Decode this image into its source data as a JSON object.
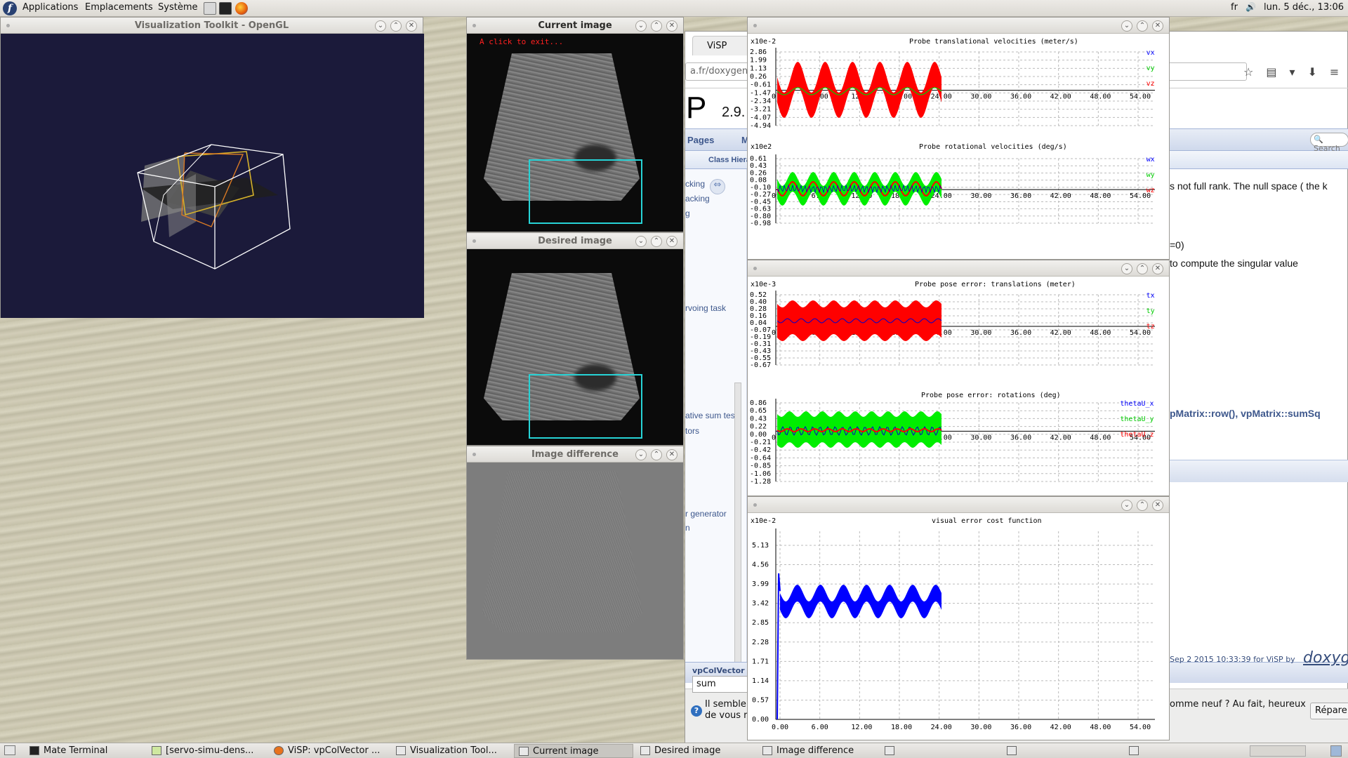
{
  "top_panel": {
    "menus": [
      "Applications",
      "Emplacements",
      "Système"
    ],
    "keyboard_layout": "fr",
    "clock": "lun.  5 déc., 13:06"
  },
  "vtk_window": {
    "title": "Visualization Toolkit - OpenGL"
  },
  "current_image": {
    "title": "Current image",
    "overlay_text": "A click to exit..."
  },
  "desired_image": {
    "title": "Desired image"
  },
  "difference_image": {
    "title": "Image difference"
  },
  "browser": {
    "tab_title": "ViSP",
    "url_fragment": "a.fr/doxygen/",
    "logo_letter": "P",
    "version": "2.9.",
    "nav": {
      "pages": "Pages",
      "m": "M",
      "class_hierarchy": "Class Hiera"
    },
    "search_placeholder": "Search",
    "sidebar_links": [
      "cking",
      "acking",
      "g",
      "rvoing task",
      "ative sum test",
      "tors",
      "r generator",
      "n"
    ],
    "doc_lines": [
      "s not full rank. The null space ( the k",
      "=0)",
      "to compute the singular value"
    ],
    "matrix_refs": "pMatrix::row(), vpMatrix::sumSq",
    "footer_left": "vpColVector",
    "footer": "Sep 2 2015 10:33:39 for ViSP by",
    "doxygen_logo": "doxyg",
    "find_value": "sum",
    "notification_line1": "Il semblerait que vous n'ayez pas d",
    "notification_line2": "de vous retrouver !",
    "notification_right": "omme neuf ? Au fait, heureux",
    "repair_button": "Répare"
  },
  "plot_top": {
    "graph1": {
      "title": "Probe translational velocities (meter/s)",
      "exponent": "x10e-2",
      "y_ticks": [
        "2.86",
        "1.99",
        "1.13",
        "0.26",
        "-0.61",
        "-1.47",
        "-2.34",
        "-3.21",
        "-4.07",
        "-4.94"
      ],
      "x_ticks": [
        "0.00",
        "6.00",
        "12.00",
        "18.00",
        "24.00",
        "30.00",
        "36.00",
        "42.00",
        "48.00",
        "54.00"
      ],
      "legend": [
        "vx",
        "vy",
        "vz"
      ]
    },
    "graph2": {
      "title": "Probe rotational velocities (deg/s)",
      "exponent": "x10e2",
      "y_ticks": [
        "0.61",
        "0.43",
        "0.26",
        "0.08",
        "-0.10",
        "-0.27",
        "-0.45",
        "-0.63",
        "-0.80",
        "-0.98"
      ],
      "x_ticks": [
        "0.00",
        "6.00",
        "12.00",
        "18.00",
        "24.00",
        "30.00",
        "36.00",
        "42.00",
        "48.00",
        "54.00"
      ],
      "legend": [
        "wx",
        "wy",
        "wz"
      ]
    }
  },
  "plot_mid": {
    "graph1": {
      "title": "Probe pose error: translations (meter)",
      "exponent": "x10e-3",
      "y_ticks": [
        "0.52",
        "0.40",
        "0.28",
        "0.16",
        "0.04",
        "-0.07",
        "-0.19",
        "-0.31",
        "-0.43",
        "-0.55",
        "-0.67"
      ],
      "x_ticks": [
        "0.00",
        "6.00",
        "12.00",
        "18.00",
        "24.00",
        "30.00",
        "36.00",
        "42.00",
        "48.00",
        "54.00"
      ],
      "legend": [
        "tx",
        "ty",
        "tz"
      ]
    },
    "graph2": {
      "title": "Probe pose error: rotations (deg)",
      "y_ticks": [
        "0.86",
        "0.65",
        "0.43",
        "0.22",
        "0.00",
        "-0.21",
        "-0.42",
        "-0.64",
        "-0.85",
        "-1.06",
        "-1.28"
      ],
      "x_ticks": [
        "0.00",
        "6.00",
        "12.00",
        "18.00",
        "24.00",
        "30.00",
        "36.00",
        "42.00",
        "48.00",
        "54.00"
      ],
      "legend": [
        "thetaU_x",
        "thetaU_y",
        "thetaU_z"
      ]
    }
  },
  "plot_bottom": {
    "title": "visual error cost function",
    "exponent": "x10e-2",
    "y_ticks": [
      "5.13",
      "4.56",
      "3.99",
      "3.42",
      "2.85",
      "2.28",
      "1.71",
      "1.14",
      "0.57",
      "0.00"
    ],
    "x_ticks": [
      "0.00",
      "6.00",
      "12.00",
      "18.00",
      "24.00",
      "30.00",
      "36.00",
      "42.00",
      "48.00",
      "54.00"
    ]
  },
  "taskbar": {
    "items": [
      "Mate Terminal",
      "[servo-simu-dens...",
      "ViSP: vpColVector ...",
      "Visualization Tool...",
      "Current image",
      "Desired image",
      "Image difference"
    ]
  },
  "colors": {
    "red": "#ff0000",
    "green": "#00ff00",
    "blue": "#0000ff",
    "roi": "#27d3d6"
  }
}
